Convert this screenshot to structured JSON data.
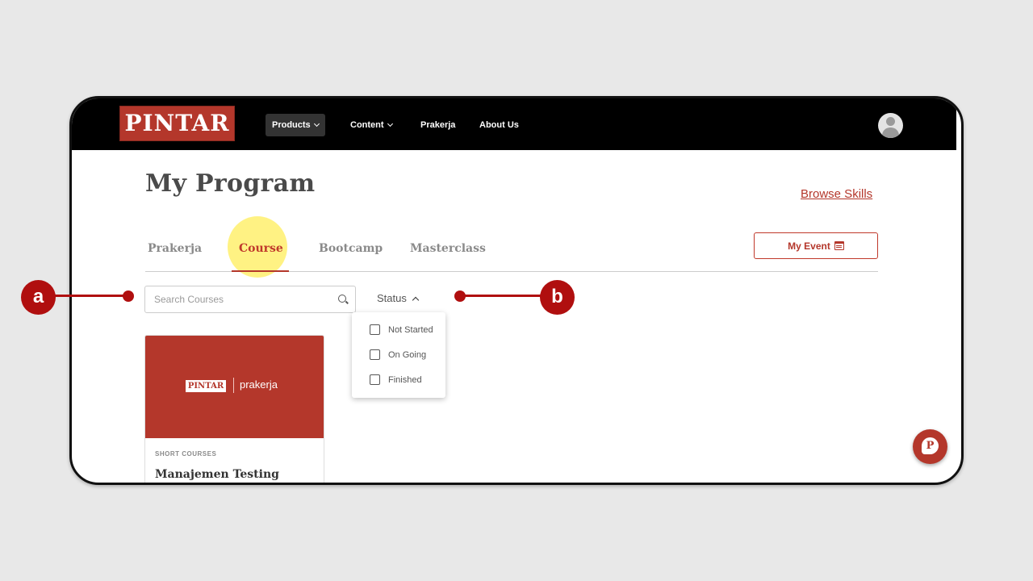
{
  "nav": {
    "logo": "PINTAR",
    "items": [
      {
        "label": "Products",
        "dropdown": true,
        "active": true
      },
      {
        "label": "Content",
        "dropdown": true,
        "active": false
      },
      {
        "label": "Prakerja",
        "dropdown": false,
        "active": false
      },
      {
        "label": "About Us",
        "dropdown": false,
        "active": false
      }
    ]
  },
  "page": {
    "title": "My Program",
    "browse_link": "Browse Skills"
  },
  "tabs": [
    {
      "label": "Prakerja",
      "active": false
    },
    {
      "label": "Course",
      "active": true
    },
    {
      "label": "Bootcamp",
      "active": false
    },
    {
      "label": "Masterclass",
      "active": false
    }
  ],
  "event_button": {
    "label": "My Event"
  },
  "search": {
    "placeholder": "Search Courses",
    "value": ""
  },
  "status_filter": {
    "label": "Status",
    "expanded": true,
    "options": [
      {
        "label": "Not Started",
        "checked": false
      },
      {
        "label": "On Going",
        "checked": false
      },
      {
        "label": "Finished",
        "checked": false
      }
    ]
  },
  "course_card": {
    "logo": "PINTAR",
    "partner": "prakerja",
    "category": "SHORT COURSES",
    "title": "Manajemen Testing"
  },
  "chat_button": {
    "glyph": "P"
  },
  "callouts": [
    {
      "label": "a"
    },
    {
      "label": "b"
    }
  ],
  "colors": {
    "brand": "#b4372b",
    "callout": "#b00f0f",
    "highlight": "#fff176"
  }
}
